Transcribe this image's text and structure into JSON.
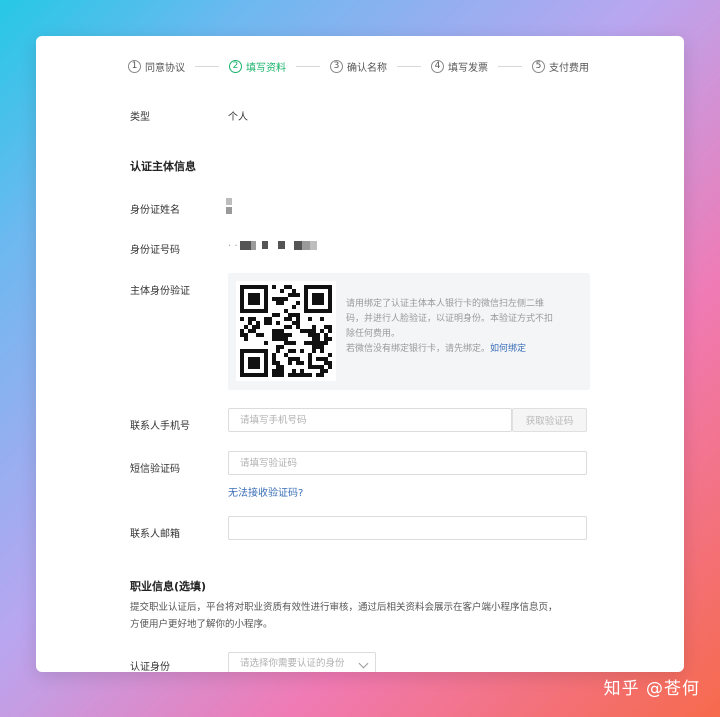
{
  "steps": [
    {
      "num": "1",
      "label": "同意协议",
      "active": false
    },
    {
      "num": "2",
      "label": "填写资料",
      "active": true
    },
    {
      "num": "3",
      "label": "确认名称",
      "active": false
    },
    {
      "num": "4",
      "label": "填写发票",
      "active": false
    },
    {
      "num": "5",
      "label": "支付费用",
      "active": false
    }
  ],
  "colors": {
    "accent": "#17b26a",
    "link": "#3b6fb6"
  },
  "type_row": {
    "label": "类型",
    "value": "个人"
  },
  "subject_section": {
    "title": "认证主体信息"
  },
  "id_name": {
    "label": "身份证姓名"
  },
  "id_number": {
    "label": "身份证号码",
    "prefix": ". ."
  },
  "verify": {
    "label": "主体身份验证",
    "lines": [
      "请用绑定了认证主体本人银行卡的微信扫左侧二维",
      "码，并进行人脸验证，以证明身份。本验证方式不扣",
      "除任何费用。"
    ],
    "note": "若微信没有绑定银行卡，请先绑定。",
    "link": "如何绑定"
  },
  "phone": {
    "label": "联系人手机号",
    "placeholder": "请填写手机号码",
    "button": "获取验证码"
  },
  "sms": {
    "label": "短信验证码",
    "placeholder": "请填写验证码",
    "help_link": "无法接收验证码?"
  },
  "email": {
    "label": "联系人邮箱",
    "placeholder": ""
  },
  "career_section": {
    "title": "职业信息(选填)",
    "desc": [
      "提交职业认证后，平台将对职业资质有效性进行审核，通过后相关资料会展示在客户端小程序信息页，",
      "方便用户更好地了解你的小程序。"
    ]
  },
  "career_identity": {
    "label": "认证身份",
    "placeholder": "请选择你需要认证的身份"
  },
  "watermark": "知乎 @苍何"
}
